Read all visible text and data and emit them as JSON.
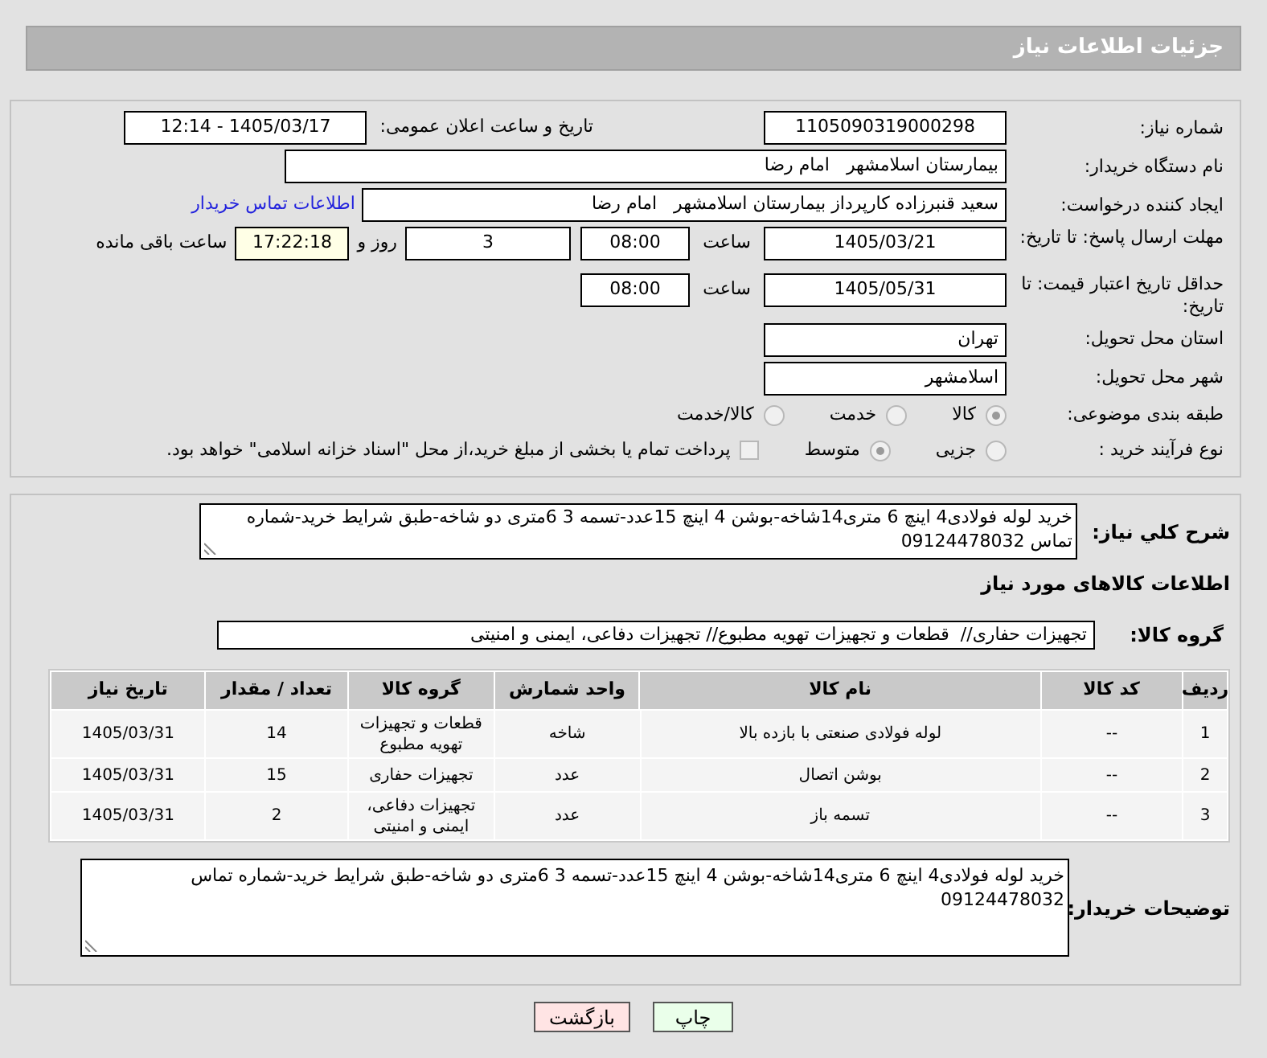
{
  "header": {
    "title": "جزئیات اطلاعات نیاز"
  },
  "need_number": {
    "label": "شماره نیاز:",
    "value": "1105090319000298"
  },
  "announce": {
    "label": "تاریخ و ساعت اعلان عمومی:",
    "value": "1405/03/17 - 12:14"
  },
  "buyer_org": {
    "label": "نام دستگاه خریدار:",
    "value": "بیمارستان اسلامشهر   امام رضا"
  },
  "requester": {
    "label": "ایجاد کننده درخواست:",
    "value": "سعید قنبرزاده کارپرداز بیمارستان اسلامشهر   امام رضا",
    "link": "اطلاعات تماس خریدار"
  },
  "response_deadline": {
    "label": "مهلت ارسال پاسخ: تا تاریخ:",
    "date": "1405/03/21",
    "time_label": "ساعت",
    "time": "08:00",
    "days": "3",
    "days_label": "روز و",
    "remaining": "17:22:18",
    "remaining_label": "ساعت باقی مانده"
  },
  "price_validity": {
    "label": "حداقل تاریخ اعتبار قیمت: تا تاریخ:",
    "date": "1405/05/31",
    "time_label": "ساعت",
    "time": "08:00"
  },
  "province": {
    "label": "استان محل تحویل:",
    "value": "تهران"
  },
  "city": {
    "label": "شهر محل تحویل:",
    "value": "اسلامشهر"
  },
  "category": {
    "label": "طبقه بندی موضوعی:",
    "options": [
      {
        "label": "کالا",
        "selected": true
      },
      {
        "label": "خدمت",
        "selected": false
      },
      {
        "label": "کالا/خدمت",
        "selected": false
      }
    ]
  },
  "process": {
    "label": "نوع فرآیند خرید :",
    "options": [
      {
        "label": "جزیی",
        "selected": false
      },
      {
        "label": "متوسط",
        "selected": true
      }
    ],
    "treasury": {
      "label": "پرداخت تمام یا بخشی از مبلغ خرید،از محل \"اسناد خزانه اسلامی\" خواهد بود.",
      "checked": false
    }
  },
  "description": {
    "label": "شرح کلي نياز:",
    "value": "خرید لوله فولادی4 اینچ 6 متری14شاخه-بوشن 4 اینچ 15عدد-تسمه 3 6متری دو شاخه-طبق شرایط خرید-شماره تماس 09124478032"
  },
  "goods_title": "اطلاعات کالاهای مورد نیاز",
  "goods_group": {
    "label": "گروه کالا:",
    "value": "تجهیزات حفاری//  قطعات و تجهیزات تهویه مطبوع// تجهیزات دفاعی، ایمنی و امنیتی"
  },
  "table": {
    "columns": [
      "ردیف",
      "کد کالا",
      "نام کالا",
      "واحد شمارش",
      "گروه کالا",
      "تعداد / مقدار",
      "تاریخ نیاز"
    ],
    "rows": [
      [
        "1",
        "--",
        "لوله فولادی صنعتی با بازده بالا",
        "شاخه",
        "قطعات و تجهیزات تهویه مطبوع",
        "14",
        "1405/03/31"
      ],
      [
        "2",
        "--",
        "بوشن اتصال",
        "عدد",
        "تجهیزات حفاری",
        "15",
        "1405/03/31"
      ],
      [
        "3",
        "--",
        "تسمه باز",
        "عدد",
        "تجهیزات دفاعی، ایمنی و امنیتی",
        "2",
        "1405/03/31"
      ]
    ]
  },
  "buyer_notes": {
    "label": "توضیحات خریدار:",
    "value": "خرید لوله فولادی4 اینچ 6 متری14شاخه-بوشن 4 اینچ 15عدد-تسمه 3 6متری دو شاخه-طبق شرایط خرید-شماره تماس 09124478032"
  },
  "buttons": [
    {
      "label": "چاپ",
      "kind": "print"
    },
    {
      "label": "بازگشت",
      "kind": "back"
    }
  ]
}
